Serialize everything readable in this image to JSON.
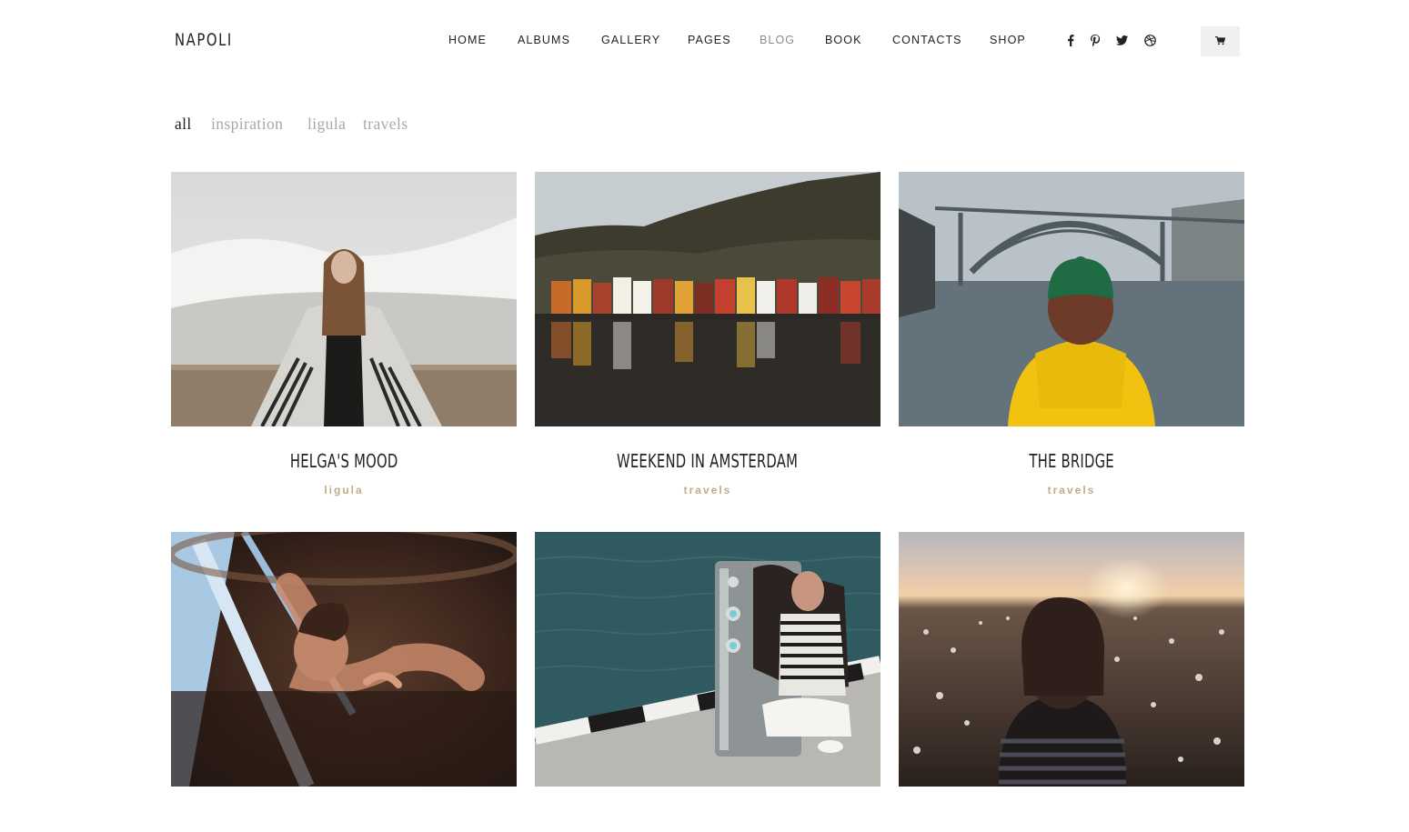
{
  "header": {
    "logo": "NAPOLI",
    "nav": [
      {
        "label": "HOME",
        "active": false
      },
      {
        "label": "ALBUMS",
        "active": false
      },
      {
        "label": "GALLERY",
        "active": false
      },
      {
        "label": "PAGES",
        "active": false
      },
      {
        "label": "BLOG",
        "active": true
      },
      {
        "label": "BOOK",
        "active": false
      },
      {
        "label": "CONTACTS",
        "active": false
      },
      {
        "label": "SHOP",
        "active": false
      }
    ],
    "social": [
      "facebook-icon",
      "pinterest-icon",
      "twitter-icon",
      "dribbble-icon"
    ],
    "cart_icon": "shopping-cart-icon"
  },
  "filters": [
    {
      "label": "all",
      "active": true
    },
    {
      "label": "inspiration",
      "active": false
    },
    {
      "label": "ligula",
      "active": false
    },
    {
      "label": "travels",
      "active": false
    }
  ],
  "posts": [
    {
      "title": "HELGA'S MOOD",
      "category": "ligula",
      "image": "woman-in-striped-poncho-snowy-field"
    },
    {
      "title": "WEEKEND IN AMSTERDAM",
      "category": "travels",
      "image": "colorful-harbor-houses-with-mountain"
    },
    {
      "title": "THE BRIDGE",
      "category": "travels",
      "image": "person-yellow-jacket-green-hat-bridge-river"
    },
    {
      "title": "",
      "category": "",
      "image": "woman-reflected-in-glass"
    },
    {
      "title": "",
      "category": "",
      "image": "woman-at-mirror-pillar-by-sea"
    },
    {
      "title": "",
      "category": "",
      "image": "girl-in-flower-field-at-sunset"
    }
  ],
  "colors": {
    "accent_category": "#c2ab87",
    "nav_active": "#8a8a8a",
    "filter_inactive": "#a8a8a8",
    "cart_bg": "#f0f0f0"
  }
}
